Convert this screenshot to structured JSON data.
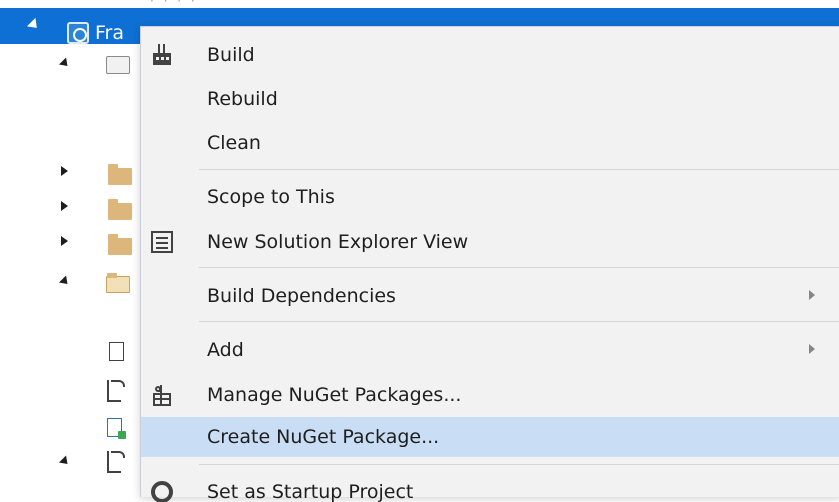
{
  "tree": {
    "selected_project_label": "Fra",
    "top_dots": "· · · ·"
  },
  "menu": {
    "items": [
      {
        "label": "Build",
        "icon": "build-icon"
      },
      {
        "label": "Rebuild",
        "icon": ""
      },
      {
        "label": "Clean",
        "icon": ""
      },
      {
        "label": "Scope to This",
        "icon": ""
      },
      {
        "label": "New Solution Explorer View",
        "icon": "new-solution-explorer-view-icon"
      },
      {
        "label": "Build Dependencies",
        "icon": "",
        "submenu": true
      },
      {
        "label": "Add",
        "icon": "",
        "submenu": true
      },
      {
        "label": "Manage NuGet Packages...",
        "icon": "nuget-icon"
      },
      {
        "label": "Create NuGet Package...",
        "icon": "",
        "highlighted": true
      },
      {
        "label": "Set as Startup Project",
        "icon": "gear-icon"
      }
    ]
  },
  "colors": {
    "selection": "#0e70d4",
    "menu_bg": "#f2f2f2",
    "menu_highlight": "#c9def5"
  }
}
